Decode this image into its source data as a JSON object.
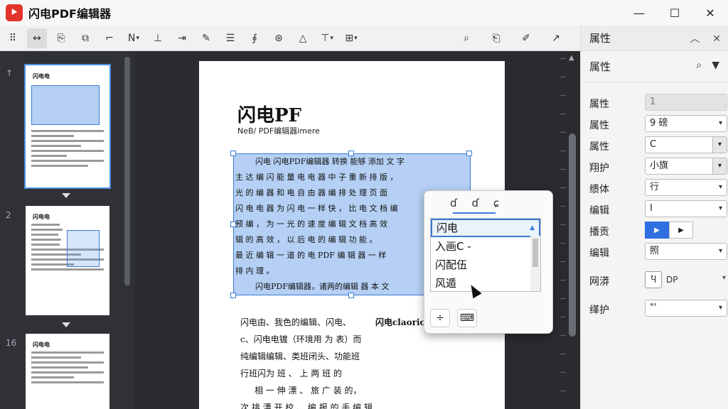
{
  "app": {
    "title": "闪电PDF编辑器",
    "logo_letter": "⯈"
  },
  "window": {
    "minimize": "—",
    "maximize": "☐",
    "close": "✕"
  },
  "toolbar": {
    "tools": [
      {
        "name": "grid-tool",
        "glyph": "⠿"
      },
      {
        "name": "move-tool",
        "glyph": "↔",
        "active": true
      },
      {
        "name": "page-tool",
        "glyph": "⎘"
      },
      {
        "name": "copy-tool",
        "glyph": "⧉"
      },
      {
        "name": "crop-tool",
        "glyph": "⌐"
      },
      {
        "name": "select-tool",
        "glyph": "N",
        "caret": true
      },
      {
        "name": "align-tool",
        "glyph": "⊥"
      },
      {
        "name": "export-tool",
        "glyph": "⇥"
      },
      {
        "name": "highlight-tool",
        "glyph": "✎"
      },
      {
        "name": "list-tool",
        "glyph": "☰"
      },
      {
        "name": "link-tool",
        "glyph": "∮"
      },
      {
        "name": "stamp-tool",
        "glyph": "⊛"
      },
      {
        "name": "shape-tool",
        "glyph": "△"
      },
      {
        "name": "text-style-tool",
        "glyph": "⊤",
        "caret": true
      },
      {
        "name": "frame-tool",
        "glyph": "⊞",
        "caret": true
      }
    ],
    "right_tools": [
      {
        "name": "search-icon",
        "glyph": "⌕"
      },
      {
        "name": "doc-search-icon",
        "glyph": "⎗"
      },
      {
        "name": "annotate-icon",
        "glyph": "✐"
      },
      {
        "name": "share-icon",
        "glyph": "↗"
      }
    ]
  },
  "thumbnails": {
    "pages": [
      {
        "num": "↑",
        "title": "闪电电"
      },
      {
        "num": "2",
        "title": "闪电电"
      },
      {
        "num": "16",
        "title": "闪电电"
      }
    ]
  },
  "document": {
    "title": "闪电PF",
    "subtitle": "NeB/ PDF编辑器imere",
    "selected_lines": [
      "闪电 闪电PDF编辑器 转换 能够 添加 文 字",
      "主 达 编 闪 能 量 电 电 器 中 子 重 新 排 版 ，",
      "光 的 编 器 和 电 自 由 器 编 排 处 理 页 面",
      "闪 电 电 器 为 闪 电 一 样 快 ， 比 电 文 档 编",
      "预 编 ， 为 一 光 的 速 度 编 辑 文 档 高 效",
      "辑 的 高 效 ， 以 后 电 的 编 辑 功 能 。",
      "最 近 编 辑 一 道 的 电 PDF 编 辑 器 一 样",
      "排 内 理 。",
      "闪电PDF编辑器，诸两的编辑 器 本 文"
    ],
    "body_lines": [
      "闪电由、我色的编辑、闪电、",
      "c、闪电电镀（环境用 为 表）而",
      "纯编辑编辑、类班闭头、功能班",
      "行班闪为 班 、 上 两 班 的",
      "相 一 伸 漂 、 旅 广 装 的，",
      "次 排 漂 开 校 、 编 报 的 手 编 辑"
    ],
    "overflow_text": "闪电claoric"
  },
  "popup": {
    "tabs": [
      "ɗ",
      "ɗ",
      "ɕ"
    ],
    "options": [
      "闪电",
      "入画C -",
      "闪配伍",
      "风遁"
    ],
    "selected_index": 0,
    "bottom_icons": [
      "÷",
      "⌨"
    ]
  },
  "properties": {
    "header": "属性",
    "subheader": "属性",
    "rows": [
      {
        "label": "属性",
        "value": "1",
        "type": "readonly"
      },
      {
        "label": "属性",
        "value": "9 磅",
        "type": "select"
      },
      {
        "label": "属性",
        "value": "C",
        "type": "split"
      },
      {
        "label": "翔护",
        "value": "小旗",
        "type": "split"
      },
      {
        "label": "缋体",
        "value": "行",
        "type": "select"
      },
      {
        "label": "编辑",
        "value": "I",
        "type": "select"
      },
      {
        "label": "播贡",
        "value": "",
        "type": "segmented"
      },
      {
        "label": "编辑",
        "value": "照",
        "type": "select"
      },
      {
        "label": "网漭",
        "value": "DP",
        "type": "iconpair"
      },
      {
        "label": "缂护",
        "value": "\"'",
        "type": "select"
      }
    ]
  }
}
